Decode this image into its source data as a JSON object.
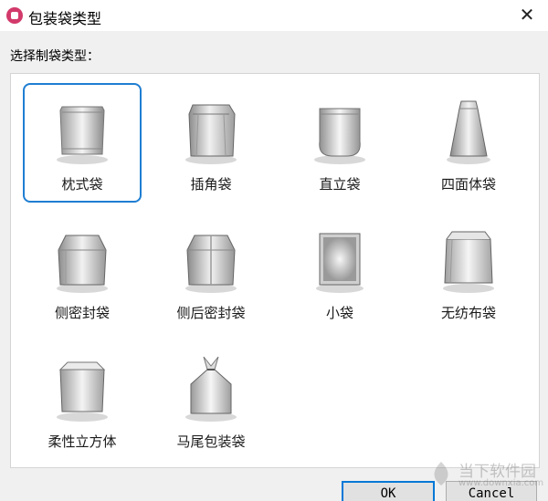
{
  "window": {
    "title": "包装袋类型",
    "close_icon": "close-x-icon",
    "app_icon": "app-pink-logo-icon"
  },
  "prompt": "选择制袋类型：",
  "tiles": [
    {
      "label": "枕式袋",
      "icon": "pillow-bag-icon",
      "selected": true
    },
    {
      "label": "插角袋",
      "icon": "gusset-bag-icon",
      "selected": false
    },
    {
      "label": "直立袋",
      "icon": "stand-up-pouch-icon",
      "selected": false
    },
    {
      "label": "四面体袋",
      "icon": "tetrahedron-bag-icon",
      "selected": false
    },
    {
      "label": "侧密封袋",
      "icon": "side-seal-bag-icon",
      "selected": false
    },
    {
      "label": "侧后密封袋",
      "icon": "side-back-seal-bag-icon",
      "selected": false
    },
    {
      "label": "小袋",
      "icon": "sachet-icon",
      "selected": false
    },
    {
      "label": "无纺布袋",
      "icon": "nonwoven-bag-icon",
      "selected": false
    },
    {
      "label": "柔性立方体",
      "icon": "flexible-cube-icon",
      "selected": false
    },
    {
      "label": "马尾包装袋",
      "icon": "ponytail-bag-icon",
      "selected": false
    }
  ],
  "buttons": {
    "ok": "OK",
    "cancel": "Cancel"
  },
  "watermark": {
    "text": "当下软件园",
    "url": "www.downxia.com"
  },
  "colors": {
    "selection": "#1f7ed2",
    "app_icon": "#d23a6b",
    "background": "#f0f0f0"
  }
}
